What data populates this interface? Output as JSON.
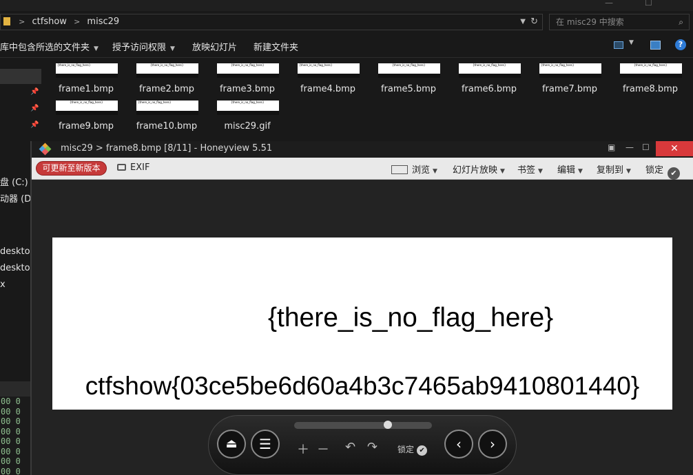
{
  "explorer": {
    "breadcrumb": [
      "ctfshow",
      "misc29"
    ],
    "search_placeholder": "在 misc29 中搜索",
    "ribbon": {
      "library": "库中包含所选的文件夹",
      "share": "授予访问权限",
      "slideshow": "放映幻灯片",
      "new_folder": "新建文件夹"
    },
    "nav_items": [
      "盘 (C:)",
      "动器 (D:",
      "desktop",
      "desktop",
      "x"
    ],
    "binary_lines": [
      "00 0",
      "00 0",
      "00 0",
      "00 0",
      "00 0",
      "00 0",
      "00 0",
      "00 0"
    ],
    "files": [
      {
        "name": "frame1.bmp",
        "thumb": "{there_is_no_flag_here}"
      },
      {
        "name": "frame2.bmp",
        "thumb": "{there_is_no_flag_here}"
      },
      {
        "name": "frame3.bmp",
        "thumb": "{there_is_no_flag_here}"
      },
      {
        "name": "frame4.bmp",
        "thumb": "{there_is_no_flag_here}"
      },
      {
        "name": "frame5.bmp",
        "thumb": "{there_is_no_flag_here}"
      },
      {
        "name": "frame6.bmp",
        "thumb": "{there_is_no_flag_here}"
      },
      {
        "name": "frame7.bmp",
        "thumb": "{there_is_no_flag_here}"
      },
      {
        "name": "frame8.bmp",
        "thumb": "{there_is_no_flag_here}"
      },
      {
        "name": "frame9.bmp",
        "thumb": "{there_is_no_flag_here}"
      },
      {
        "name": "frame10.bmp",
        "thumb": "{there_is_no_flag_here}"
      },
      {
        "name": "misc29.gif",
        "thumb": "{there_is_no_flag_here}"
      }
    ]
  },
  "viewer": {
    "title": "misc29 > frame8.bmp [8/11] - Honeyview 5.51",
    "update_button": "可更新至新版本",
    "exif": "EXIF",
    "browse": "浏览",
    "slideshow": "幻灯片放映",
    "bookmark": "书签",
    "edit": "编辑",
    "copy_to": "复制到",
    "lock": "锁定",
    "image_line1": "{there_is_no_flag_here}",
    "image_line2": "ctfshow{03ce5be6d60a4b3c7465ab9410801440}",
    "bottom_lock": "锁定",
    "slider_position": 0.68
  }
}
